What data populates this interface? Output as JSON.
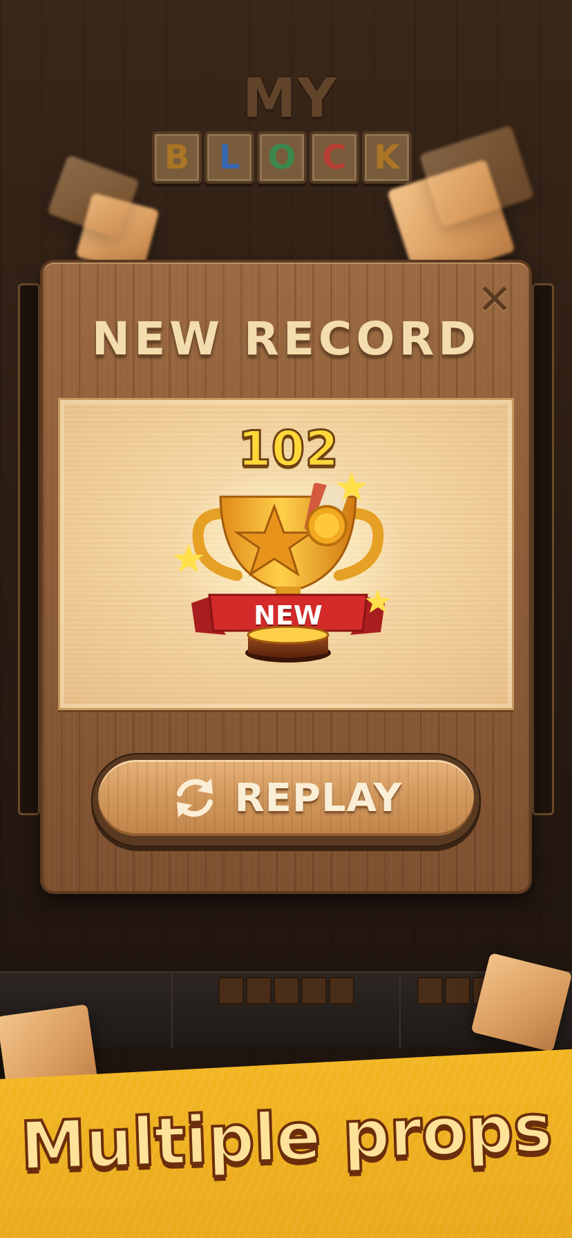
{
  "logo": {
    "top_word": "MY",
    "tiles": [
      {
        "letter": "B",
        "color": "#c98a2a"
      },
      {
        "letter": "L",
        "color": "#3a7ad6"
      },
      {
        "letter": "O",
        "color": "#3ea25a"
      },
      {
        "letter": "C",
        "color": "#d6453a"
      },
      {
        "letter": "K",
        "color": "#c98a2a"
      }
    ]
  },
  "modal": {
    "title": "NEW RECORD",
    "close_icon": "close-icon",
    "score": "102",
    "trophy_ribbon": "NEW",
    "replay_label": "REPLAY",
    "replay_icon": "refresh-icon"
  },
  "banner": {
    "text": "Multiple props"
  },
  "colors": {
    "wood": "#8b5c37",
    "parchment": "#f2d19c",
    "score_gold": "#ffd83a",
    "banner_yellow": "#f2b623",
    "ribbon_red": "#d42a2a"
  }
}
